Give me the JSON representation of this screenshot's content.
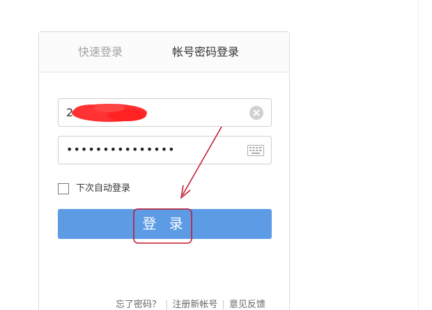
{
  "tabs": {
    "quick_login": "快速登录",
    "account_login": "帐号密码登录"
  },
  "form": {
    "username_value": "2",
    "password_dots": "•••••••••••••••",
    "remember_label": "下次自动登录",
    "login_button": "登 录"
  },
  "footer": {
    "forgot_password": "忘了密码？",
    "register": "注册新帐号",
    "feedback": "意见反馈"
  },
  "colors": {
    "login_button": "#5d9be5",
    "annotation": "#c0152a"
  },
  "icons": {
    "clear": "clear-icon",
    "keyboard": "keyboard-icon"
  }
}
